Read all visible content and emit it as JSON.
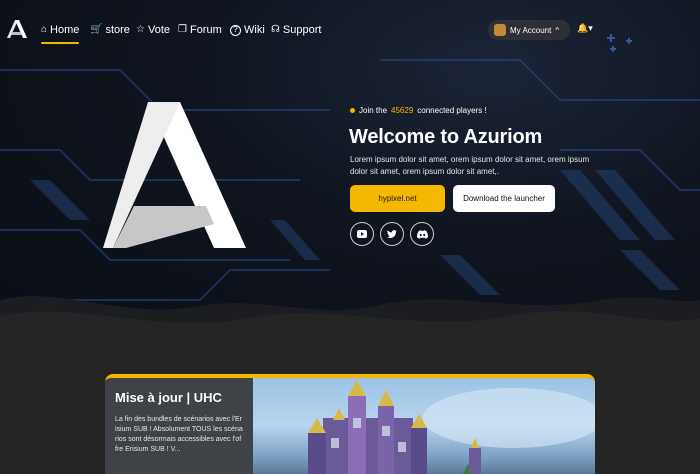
{
  "nav": {
    "items": [
      {
        "label": "Home",
        "icon": "home-icon",
        "glyph": "⌂",
        "active": true
      },
      {
        "label": "store",
        "icon": "basket-icon",
        "glyph": "🛒",
        "active": false
      },
      {
        "label": "Vote",
        "icon": "star-icon",
        "glyph": "☆",
        "active": false
      },
      {
        "label": "Forum",
        "icon": "book-icon",
        "glyph": "❒",
        "active": false
      },
      {
        "label": "Wiki",
        "icon": "question-icon",
        "glyph": "?",
        "active": false
      },
      {
        "label": "Support",
        "icon": "headset-icon",
        "glyph": "☊",
        "active": false
      }
    ],
    "account_label": "My Account",
    "account_caret": "^",
    "bell": "🔔▾"
  },
  "hero": {
    "join_prefix": "Join the",
    "players": "45629",
    "join_suffix": "connected players !",
    "title": "Welcome to Azuriom",
    "lead": "Lorem ipsum dolor sit amet, orem ipsum dolor sit amet, orem ipsum dolor sit amet, orem ipsum dolor sit amet,.",
    "primary_button": "hypixel.net",
    "secondary_button": "Download the launcher",
    "socials": [
      {
        "icon": "youtube-icon",
        "glyph": "▶"
      },
      {
        "icon": "twitter-icon",
        "glyph": "🐦"
      },
      {
        "icon": "discord-icon",
        "glyph": "☺"
      }
    ]
  },
  "article": {
    "title": "Mise à jour | UHC",
    "body": "La fin des bundles de scénarios avec l'Erisium SUB ! Absolument TOUS les scénarios sont désormais accessibles avec l'offre Erisium SUB ! V..."
  },
  "colors": {
    "accent": "#f5b800",
    "bg": "#242424",
    "hero": "#0f141e"
  }
}
